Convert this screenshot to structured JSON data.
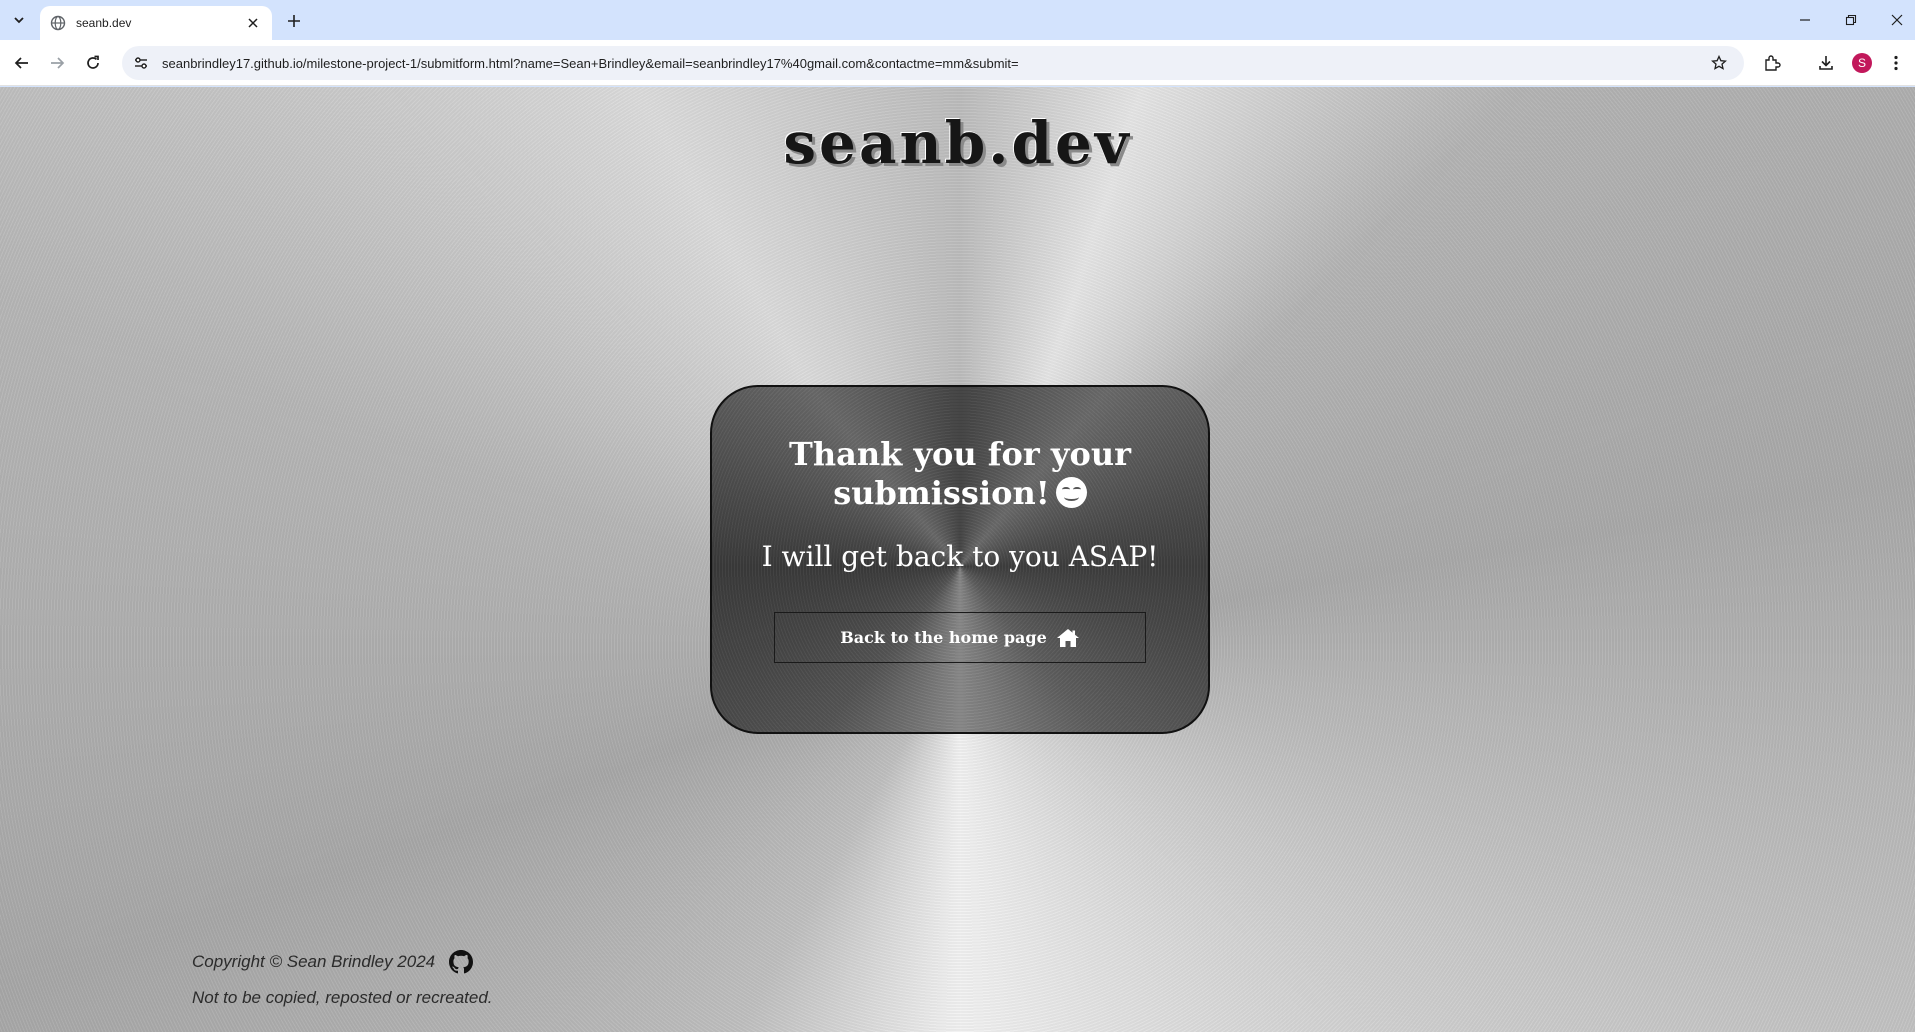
{
  "browser": {
    "tab_title": "seanb.dev",
    "url": "seanbrindley17.github.io/milestone-project-1/submitform.html?name=Sean+Brindley&email=seanbrindley17%40gmail.com&contactme=mm&submit=",
    "profile_initial": "S"
  },
  "page": {
    "site_title": "seanb.dev",
    "card": {
      "heading": "Thank you for your submission!",
      "subheading": "I will get back to you ASAP!",
      "button_label": "Back to the home page"
    },
    "footer": {
      "copyright": "Copyright © Sean Brindley 2024",
      "notice": "Not to be copied, reposted or recreated."
    }
  },
  "icons": {
    "tab_search": "chevron-down-icon",
    "favicon": "globe-icon",
    "home": "house-icon",
    "social": "github-icon"
  }
}
